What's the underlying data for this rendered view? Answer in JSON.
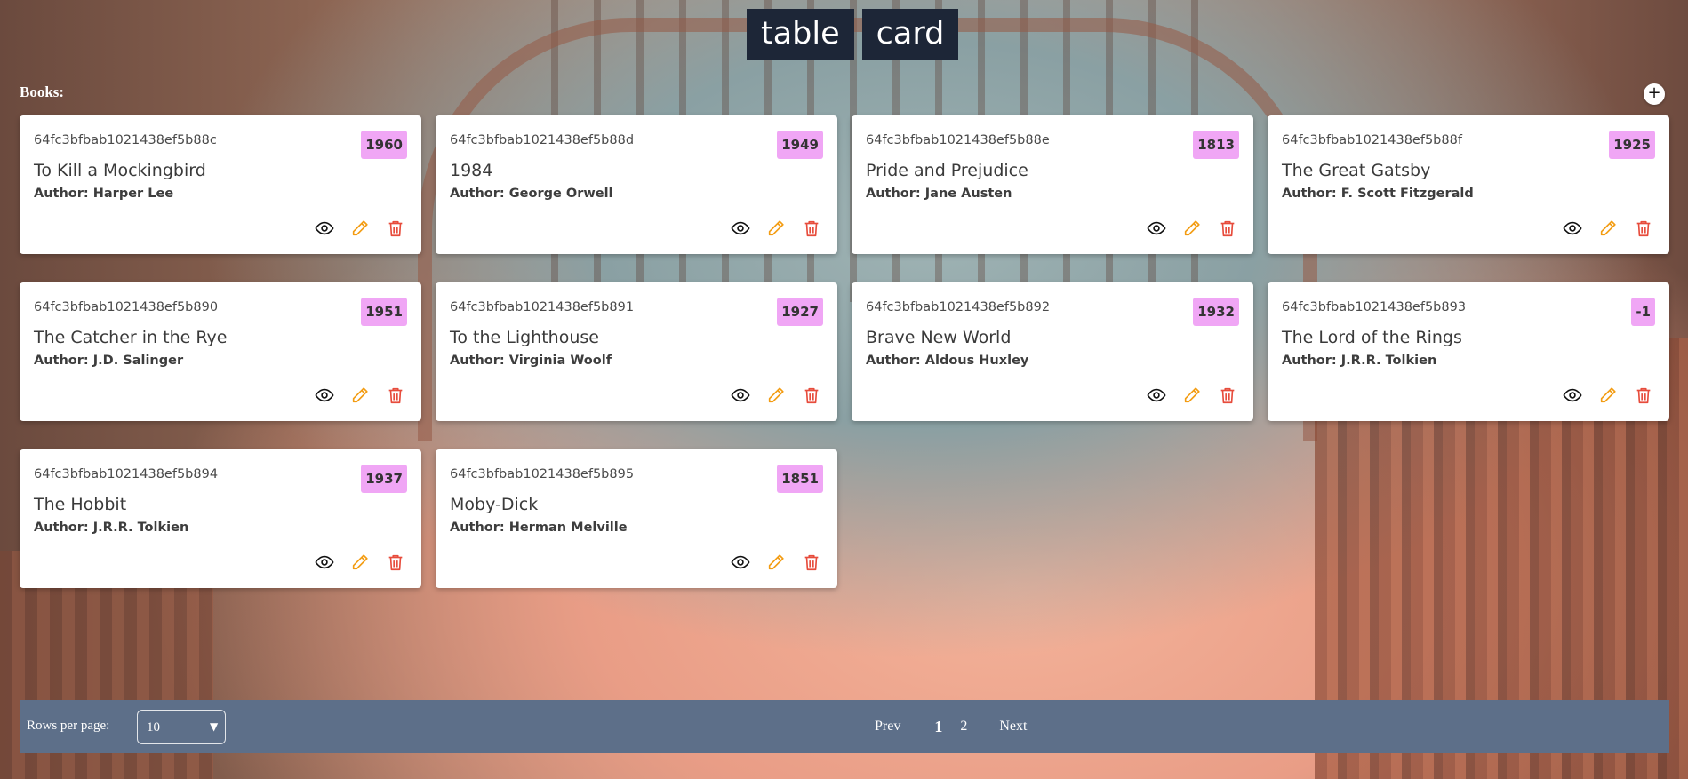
{
  "view_toggle": {
    "table_label": "table",
    "card_label": "card"
  },
  "section": {
    "title": "Books:",
    "add_icon": "+"
  },
  "books": [
    {
      "id": "64fc3bfbab1021438ef5b88c",
      "year": "1960",
      "title": "To Kill a Mockingbird",
      "author": "Author: Harper Lee"
    },
    {
      "id": "64fc3bfbab1021438ef5b88d",
      "year": "1949",
      "title": "1984",
      "author": "Author: George Orwell"
    },
    {
      "id": "64fc3bfbab1021438ef5b88e",
      "year": "1813",
      "title": "Pride and Prejudice",
      "author": "Author: Jane Austen"
    },
    {
      "id": "64fc3bfbab1021438ef5b88f",
      "year": "1925",
      "title": "The Great Gatsby",
      "author": "Author: F. Scott Fitzgerald"
    },
    {
      "id": "64fc3bfbab1021438ef5b890",
      "year": "1951",
      "title": "The Catcher in the Rye",
      "author": "Author: J.D. Salinger"
    },
    {
      "id": "64fc3bfbab1021438ef5b891",
      "year": "1927",
      "title": "To the Lighthouse",
      "author": "Author: Virginia Woolf"
    },
    {
      "id": "64fc3bfbab1021438ef5b892",
      "year": "1932",
      "title": "Brave New World",
      "author": "Author: Aldous Huxley"
    },
    {
      "id": "64fc3bfbab1021438ef5b893",
      "year": "-1",
      "title": "The Lord of the Rings",
      "author": "Author: J.R.R. Tolkien"
    },
    {
      "id": "64fc3bfbab1021438ef5b894",
      "year": "1937",
      "title": "The Hobbit",
      "author": "Author: J.R.R. Tolkien"
    },
    {
      "id": "64fc3bfbab1021438ef5b895",
      "year": "1851",
      "title": "Moby-Dick",
      "author": "Author: Herman Melville"
    }
  ],
  "card_actions": {
    "view_icon": "eye-icon",
    "edit_icon": "pencil-icon",
    "delete_icon": "trash-icon"
  },
  "colors": {
    "year_badge": "#f0a6f5",
    "edit": "#f39c12",
    "delete": "#e74c3c",
    "footer": "#5d6f89",
    "toggle_bg": "#1d2637"
  },
  "pagination": {
    "rows_label": "Rows per page:",
    "rows_value": "10",
    "prev_label": "Prev",
    "pages": [
      "1",
      "2"
    ],
    "current_page": "1",
    "next_label": "Next"
  }
}
